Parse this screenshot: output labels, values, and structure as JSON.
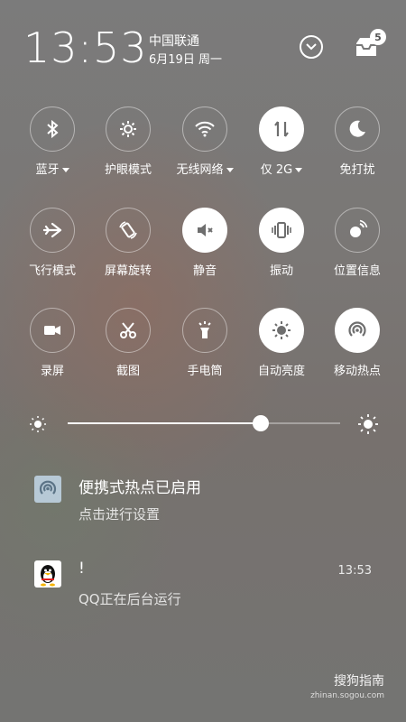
{
  "status": {
    "time": "13:53",
    "carrier": "中国联通",
    "date": "6月19日 周一",
    "notification_count": "5"
  },
  "tiles": [
    {
      "label": "蓝牙",
      "icon": "bluetooth-icon",
      "on": false,
      "dropdown": true
    },
    {
      "label": "护眼模式",
      "icon": "eye-care-icon",
      "on": false,
      "dropdown": false
    },
    {
      "label": "无线网络",
      "icon": "wifi-icon",
      "on": false,
      "dropdown": true
    },
    {
      "label": "仅 2G",
      "icon": "mobile-data-icon",
      "on": true,
      "dropdown": true
    },
    {
      "label": "免打扰",
      "icon": "moon-icon",
      "on": false,
      "dropdown": false
    },
    {
      "label": "飞行模式",
      "icon": "airplane-icon",
      "on": false,
      "dropdown": false
    },
    {
      "label": "屏幕旋转",
      "icon": "rotate-icon",
      "on": false,
      "dropdown": false
    },
    {
      "label": "静音",
      "icon": "mute-icon",
      "on": true,
      "dropdown": false
    },
    {
      "label": "振动",
      "icon": "vibrate-icon",
      "on": true,
      "dropdown": false
    },
    {
      "label": "位置信息",
      "icon": "location-icon",
      "on": false,
      "dropdown": false
    },
    {
      "label": "录屏",
      "icon": "screen-record-icon",
      "on": false,
      "dropdown": false
    },
    {
      "label": "截图",
      "icon": "scissors-icon",
      "on": false,
      "dropdown": false
    },
    {
      "label": "手电筒",
      "icon": "flashlight-icon",
      "on": false,
      "dropdown": false
    },
    {
      "label": "自动亮度",
      "icon": "auto-brightness-icon",
      "on": true,
      "dropdown": false
    },
    {
      "label": "移动热点",
      "icon": "hotspot-icon",
      "on": true,
      "dropdown": false
    }
  ],
  "brightness": {
    "level": 0.71
  },
  "notifications": [
    {
      "title": "便携式热点已启用",
      "subtitle": "点击进行设置",
      "time": ""
    },
    {
      "title": "!",
      "subtitle": "QQ正在后台运行",
      "time": "13:53"
    }
  ],
  "watermark": {
    "main": "搜狗指南",
    "sub": "zhinan.sogou.com"
  }
}
